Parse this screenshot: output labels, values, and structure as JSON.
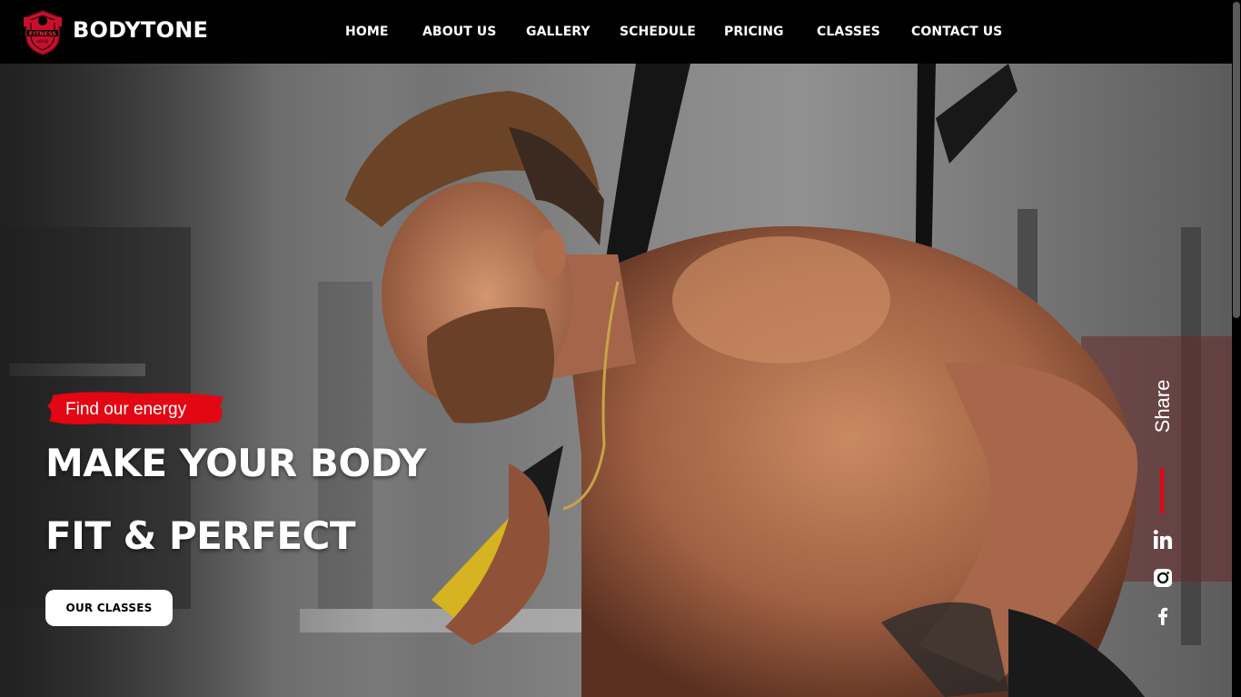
{
  "header": {
    "logo_text": "FITNESS LOGO",
    "brand": "BODYTONE",
    "nav": [
      "HOME",
      "ABOUT US",
      "GALLERY",
      "SCHEDULE",
      "PRICING",
      "CLASSES",
      "CONTACT US"
    ]
  },
  "hero": {
    "tagline": "Find our energy",
    "headline_line1": "MAKE YOUR BODY",
    "headline_line2": "FIT & PERFECT",
    "cta_label": "OUR CLASSES",
    "image_alt": "Athlete training with suspension straps in a gym"
  },
  "share": {
    "label": "Share",
    "icons": [
      "linkedin-icon",
      "instagram-icon",
      "facebook-icon"
    ]
  },
  "colors": {
    "accent": "#e30613",
    "header_bg": "#000000",
    "button_bg": "#ffffff"
  }
}
